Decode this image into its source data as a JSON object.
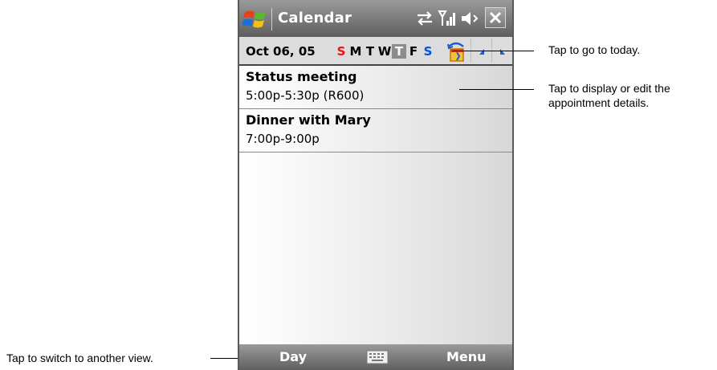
{
  "window": {
    "title": "Calendar"
  },
  "datebar": {
    "date": "Oct 06, 05",
    "weekdays": [
      "S",
      "M",
      "T",
      "W",
      "T",
      "F",
      "S"
    ],
    "selected_index": 4
  },
  "appointments": [
    {
      "title": "Status meeting",
      "time": "5:00p-5:30p (R600)"
    },
    {
      "title": "Dinner with Mary",
      "time": "7:00p-9:00p"
    }
  ],
  "softkeys": {
    "left": "Day",
    "right": "Menu"
  },
  "callouts": {
    "today": "Tap to go to today.",
    "details_line1": "Tap to display or edit the",
    "details_line2": "appointment details.",
    "switch_view": "Tap to switch to another view."
  },
  "colors": {
    "sunday": "#ee1111",
    "saturday": "#0055dd",
    "selected_day_bg": "#8c8c8c"
  },
  "icons": [
    "windows-start-icon",
    "sync-icon",
    "signal-icon",
    "speaker-icon",
    "close-icon",
    "today-icon",
    "prev-arrow-icon",
    "next-arrow-icon",
    "keyboard-icon"
  ]
}
